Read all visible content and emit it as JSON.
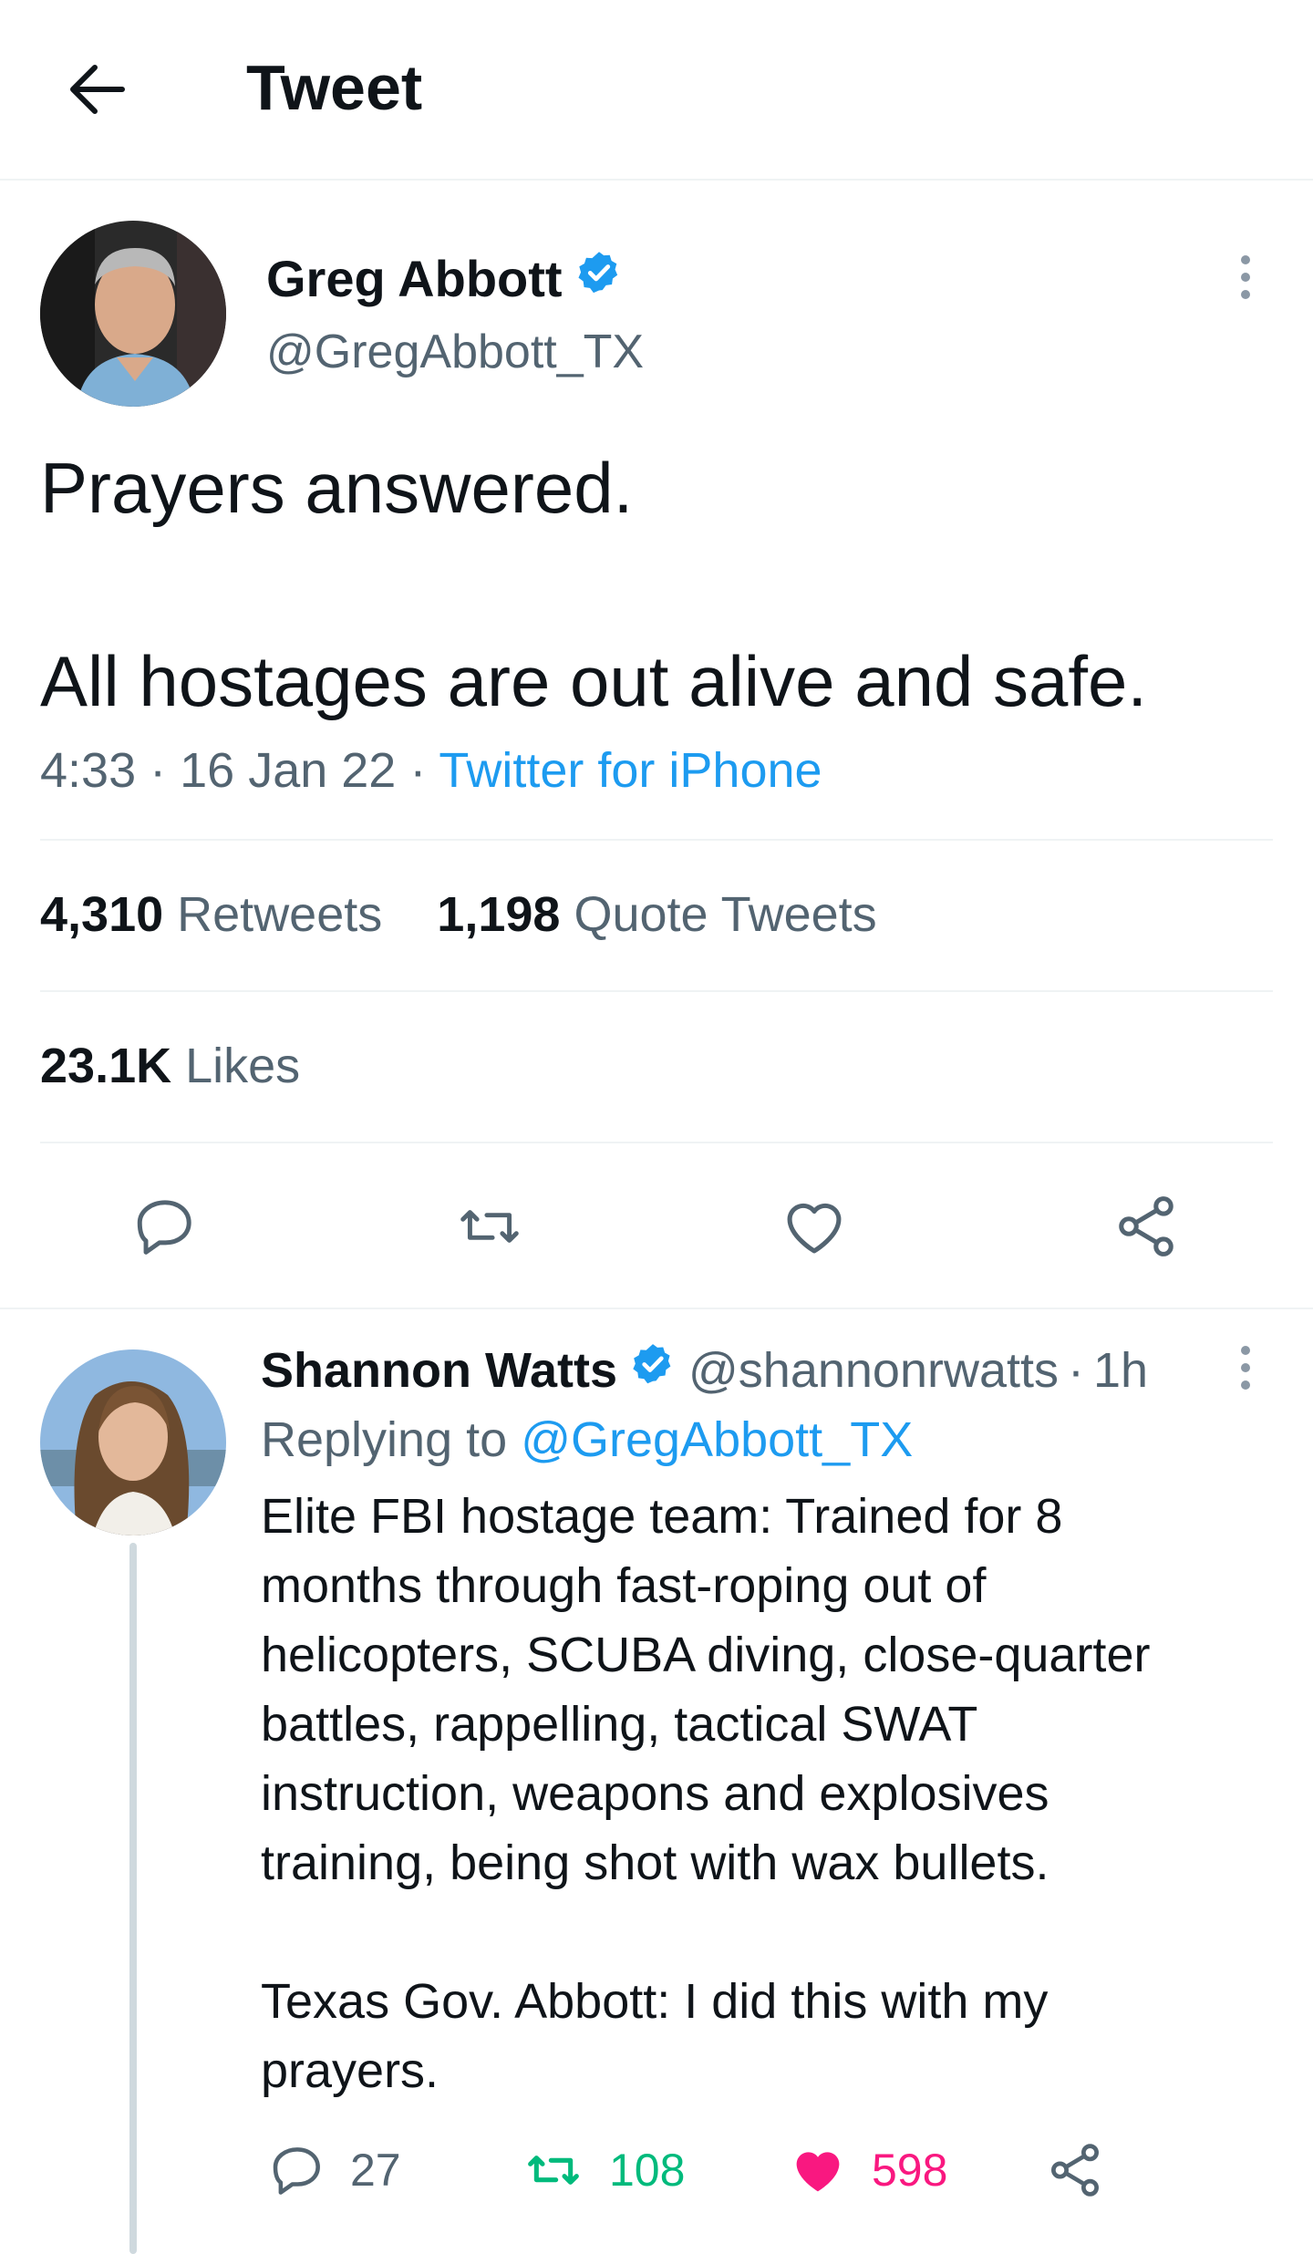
{
  "header": {
    "title": "Tweet"
  },
  "tweet": {
    "author_name": "Greg Abbott",
    "author_handle": "@GregAbbott_TX",
    "text_line1": "Prayers answered.",
    "text_line2": "All hostages are out alive and safe.",
    "time": "4:33",
    "date": "16 Jan 22",
    "source": "Twitter for iPhone",
    "retweets_count": "4,310",
    "retweets_label": "Retweets",
    "quotes_count": "1,198",
    "quotes_label": "Quote Tweets",
    "likes_count": "23.1K",
    "likes_label": "Likes"
  },
  "reply": {
    "author_name": "Shannon Watts",
    "author_handle": "@shannonrwatts",
    "age": "1h",
    "replying_prefix": "Replying to",
    "replying_mention": "@GregAbbott_TX",
    "text": "Elite FBI hostage team: Trained for 8\nmonths through fast-roping out of\nhelicopters, SCUBA diving, close-quarter\nbattles, rappelling, tactical SWAT\ninstruction, weapons and explosives\ntraining, being shot with wax bullets.\n\nTexas Gov. Abbott: I did this with my\nprayers.",
    "reply_count": "27",
    "retweet_count": "108",
    "like_count": "598"
  },
  "colors": {
    "accent": "#1d9bf0",
    "retweet_active": "#00ba7c",
    "like_active": "#f91880",
    "secondary_text": "#536471"
  },
  "icons": [
    "back-arrow-icon",
    "verified-badge-icon",
    "more-icon",
    "reply-icon",
    "retweet-icon",
    "like-icon",
    "share-icon"
  ]
}
